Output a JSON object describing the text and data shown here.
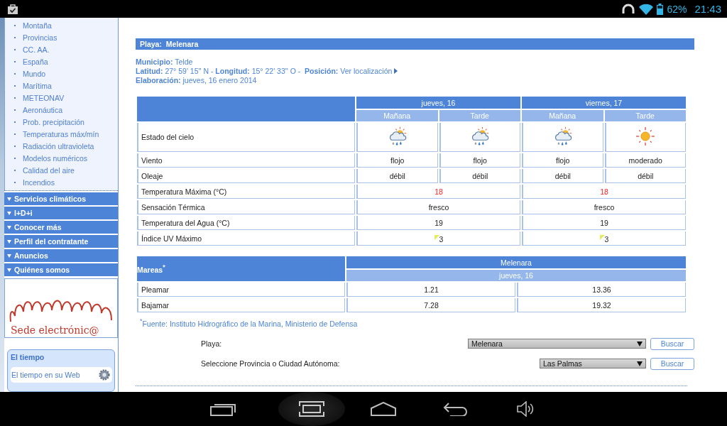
{
  "status_bar": {
    "battery": "62%",
    "time": "21:43"
  },
  "sidebar": {
    "links": [
      "Montaña",
      "Provincias",
      "CC. AA.",
      "España",
      "Mundo",
      "Marítima",
      "METEONAV",
      "Aeronáutica",
      "Prob. precipitación",
      "Temperaturas máx/mín",
      "Radiación ultravioleta",
      "Modelos numéricos",
      "Calidad del aire",
      "Incendios"
    ],
    "sections": [
      "Servicios climáticos",
      "I+D+i",
      "Conocer más",
      "Perfil del contratante",
      "Anuncios",
      "Quiénes somos"
    ],
    "logo_text": "Sede electrónic@",
    "widget": {
      "title": "El tiempo",
      "item": "El tiempo en su Web"
    }
  },
  "beach": {
    "title": "Playa:  Melenara",
    "info": [
      {
        "text": "**Municipio:** Telde"
      },
      {
        "text": "**Latitud:** 27° 59' 15'' N - **Longitud:** 15° 22' 33'' O -  **Posición:**",
        "link": "Ver localización"
      },
      {
        "text": "**Elaboración:** jueves, 16 enero 2014"
      }
    ]
  },
  "forecast": {
    "days": [
      {
        "label": "jueves, 16",
        "periods": [
          {
            "label": "Mañana",
            "kind": "showers"
          },
          {
            "label": "Tarde",
            "kind": "showers"
          }
        ]
      },
      {
        "label": "viernes, 17",
        "periods": [
          {
            "label": "Mañana",
            "kind": "showers"
          },
          {
            "label": "Tarde",
            "kind": "sunny"
          }
        ]
      }
    ],
    "sky_label": "Estado del cielo",
    "rows": [
      {
        "label": "Viento",
        "kind": "period",
        "values": [
          "flojo",
          "flojo",
          "flojo",
          "moderado"
        ]
      },
      {
        "label": "Oleaje",
        "kind": "period",
        "values": [
          "débil",
          "débil",
          "débil",
          "débil"
        ]
      },
      {
        "label": "Temperatura Máxima (°C)",
        "kind": "temperature",
        "values": [
          "18",
          "18"
        ]
      },
      {
        "label": "Sensación Térmica",
        "kind": "day",
        "values": [
          "fresco",
          "fresco"
        ]
      },
      {
        "label": "Temperatura del Agua (°C)",
        "kind": "day",
        "values": [
          "19",
          "19"
        ]
      },
      {
        "label": "Índice UV Máximo",
        "kind": "uv",
        "values": [
          "3",
          "3"
        ]
      }
    ]
  },
  "tides": {
    "title": "Mareas$^{*}$",
    "location": "Melenara",
    "day": "jueves, 16",
    "rows": [
      {
        "label": "Pleamar",
        "values": [
          "1.21",
          "13.36"
        ]
      },
      {
        "label": "Bajamar",
        "values": [
          "7.28",
          "19.32"
        ]
      }
    ],
    "footnote": "$^{*}$Fuente: Instituto Hidrográfico de la Marina, Ministerio de Defensa"
  },
  "search": [
    {
      "label": "Playa:",
      "value": "Melenara",
      "button": "Buscar"
    },
    {
      "label": "Seleccione Provincia o Ciudad Autónoma:",
      "value": "Las Palmas",
      "button": "Buscar"
    }
  ]
}
